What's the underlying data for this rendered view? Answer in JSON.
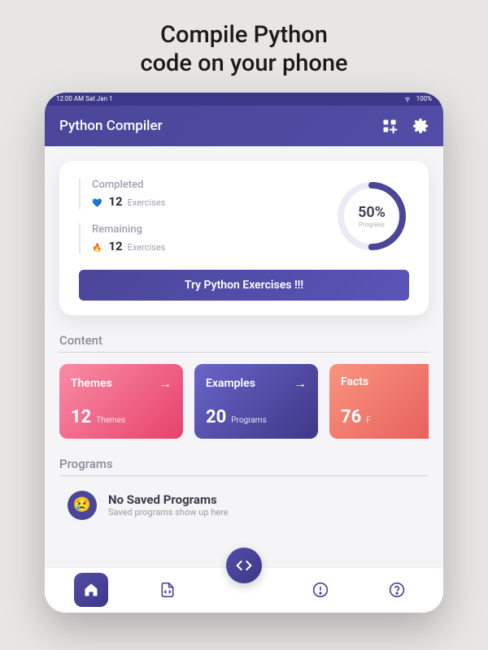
{
  "promo": {
    "line1": "Compile Python",
    "line2": "code on your phone"
  },
  "statusbar": {
    "time": "12:00 AM  Sat Jan 1",
    "battery": "100%"
  },
  "header": {
    "title": "Python Compiler"
  },
  "stats": {
    "completed": {
      "label": "Completed",
      "count": "12",
      "unit": "Exercises",
      "icon": "💙"
    },
    "remaining": {
      "label": "Remaining",
      "count": "12",
      "unit": "Exercises",
      "icon": "🔥"
    },
    "progress": {
      "percent": "50%",
      "label": "Progress",
      "value": 50
    }
  },
  "cta": {
    "label": "Try Python Exercises !!!"
  },
  "sections": {
    "content": {
      "title": "Content"
    },
    "programs": {
      "title": "Programs"
    }
  },
  "content_cards": [
    {
      "title": "Themes",
      "count": "12",
      "unit": "Themes"
    },
    {
      "title": "Examples",
      "count": "20",
      "unit": "Programs"
    },
    {
      "title": "Facts",
      "count": "76",
      "unit": "F"
    }
  ],
  "programs_empty": {
    "title": "No Saved Programs",
    "subtitle": "Saved programs show up here",
    "emoji": "😢"
  }
}
